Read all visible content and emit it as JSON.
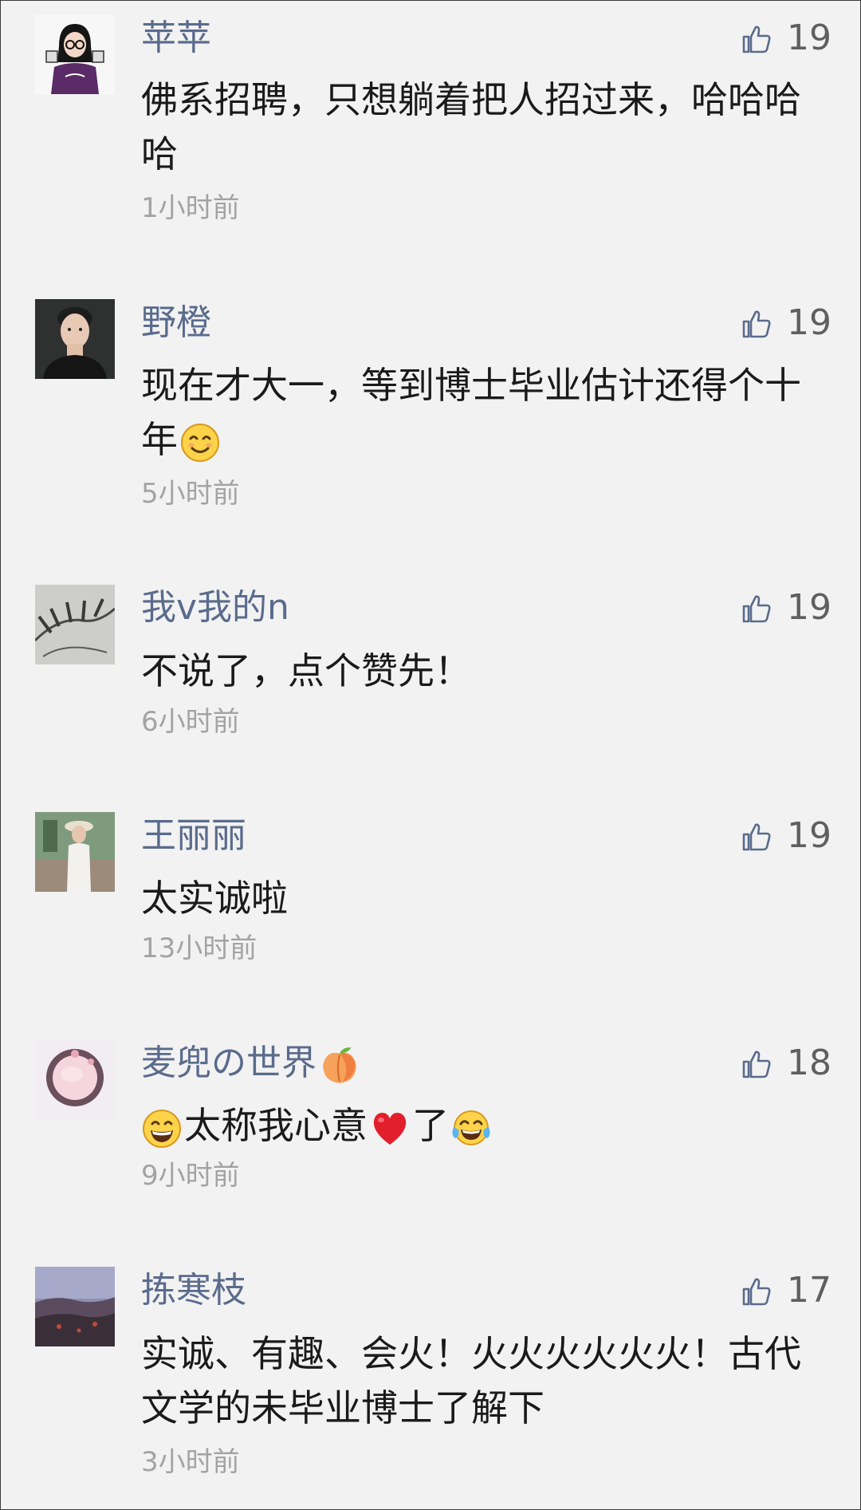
{
  "comments": [
    {
      "name": "苹苹",
      "likes": "19",
      "text": "佛系招聘，只想躺着把人招过来，哈哈哈哈",
      "time": "1小时前"
    },
    {
      "name": "野橙",
      "likes": "19",
      "text": "现在才大一，等到博士毕业估计还得个十年",
      "time": "5小时前"
    },
    {
      "name": "我v我的n",
      "likes": "19",
      "text": "不说了，点个赞先！",
      "time": "6小时前"
    },
    {
      "name": "王丽丽",
      "likes": "19",
      "text": "太实诚啦",
      "time": "13小时前"
    },
    {
      "name": "麦兜の世界",
      "likes": "18",
      "text_parts": [
        "太称我心意",
        "了"
      ],
      "time": "9小时前"
    },
    {
      "name": "拣寒枝",
      "likes": "17",
      "text": "实诚、有趣、会火！火火火火火火！古代文学的未毕业博士了解下",
      "time": "3小时前"
    }
  ],
  "icons": {
    "like": "thumbs-up-outline-icon",
    "smile": "smiling-face-emoji",
    "grin": "grinning-face-emoji",
    "heart": "red-heart-emoji",
    "tears": "tears-of-joy-emoji",
    "peach": "peach-emoji"
  },
  "colors": {
    "background": "#f2f2f2",
    "name": "#5a6b8c",
    "text": "#1a1a1a",
    "time": "#a3a3a3",
    "like": "#5f5f5f"
  }
}
